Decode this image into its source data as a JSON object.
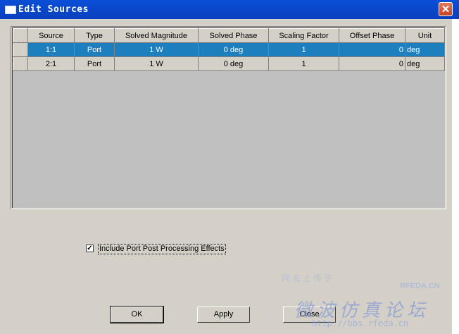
{
  "window": {
    "title": "Edit Sources",
    "close_glyph": "✕"
  },
  "table": {
    "columns": [
      "Source",
      "Type",
      "Solved Magnitude",
      "Solved Phase",
      "Scaling Factor",
      "Offset Phase",
      "Unit"
    ],
    "rows": [
      {
        "source": "1:1",
        "type": "Port",
        "solved_magnitude": "1 W",
        "solved_phase": "0 deg",
        "scaling_factor": "1",
        "offset_phase": "0",
        "unit": "deg",
        "selected": true
      },
      {
        "source": "2:1",
        "type": "Port",
        "solved_magnitude": "1 W",
        "solved_phase": "0 deg",
        "scaling_factor": "1",
        "offset_phase": "0",
        "unit": "deg",
        "selected": false
      }
    ]
  },
  "options": {
    "include_port_label": "Include Port Post Processing Effects",
    "include_port_checked": true,
    "check_glyph": "✓"
  },
  "buttons": {
    "ok": "OK",
    "apply": "Apply",
    "close": "Close"
  },
  "watermark": {
    "line1": "网友上传于",
    "brand": "RFEDA.CN",
    "cn_text": "微波仿真论坛",
    "url": "http://bbs.rfeda.cn"
  }
}
